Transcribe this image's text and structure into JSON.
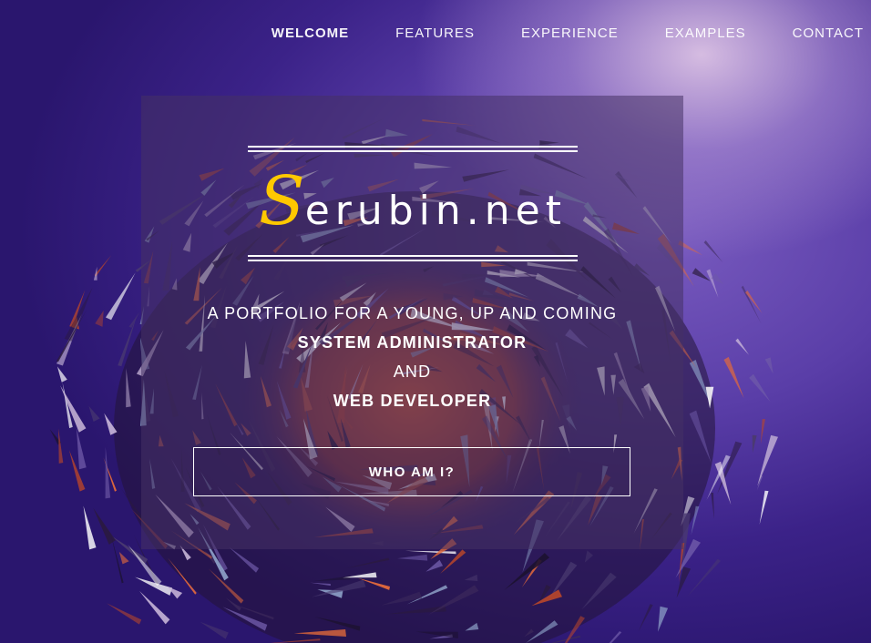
{
  "nav": {
    "items": [
      {
        "label": "WELCOME",
        "active": true
      },
      {
        "label": "FEATURES",
        "active": false
      },
      {
        "label": "EXPERIENCE",
        "active": false
      },
      {
        "label": "EXAMPLES",
        "active": false
      },
      {
        "label": "CONTACT",
        "active": false
      }
    ]
  },
  "hero": {
    "logo_initial": "S",
    "logo_rest": "erubin.net",
    "tagline": {
      "line1": "A PORTFOLIO FOR A YOUNG, UP AND COMING",
      "line2": "SYSTEM ADMINISTRATOR",
      "line3": "AND",
      "line4": "WEB DEVELOPER"
    },
    "cta_label": "WHO AM I?"
  },
  "colors": {
    "accent": "#ffc800",
    "background_deep": "#2a166e",
    "background_glow": "#7a5cc0"
  }
}
